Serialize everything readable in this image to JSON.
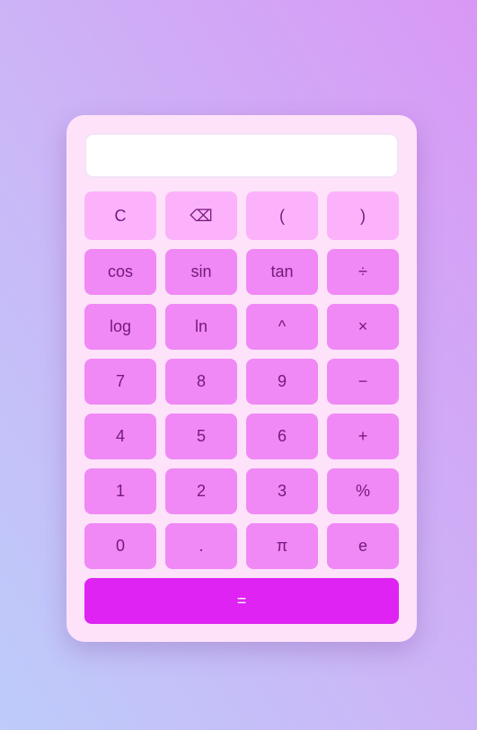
{
  "display": {
    "value": ""
  },
  "keys": [
    {
      "label": "C",
      "name": "clear-button",
      "kind": "top"
    },
    {
      "label": "⌫",
      "name": "backspace-button",
      "kind": "top"
    },
    {
      "label": "(",
      "name": "open-paren-button",
      "kind": "top"
    },
    {
      "label": ")",
      "name": "close-paren-button",
      "kind": "top"
    },
    {
      "label": "cos",
      "name": "cos-button",
      "kind": "normal"
    },
    {
      "label": "sin",
      "name": "sin-button",
      "kind": "normal"
    },
    {
      "label": "tan",
      "name": "tan-button",
      "kind": "normal"
    },
    {
      "label": "÷",
      "name": "divide-button",
      "kind": "normal"
    },
    {
      "label": "log",
      "name": "log-button",
      "kind": "normal"
    },
    {
      "label": "ln",
      "name": "ln-button",
      "kind": "normal"
    },
    {
      "label": "^",
      "name": "power-button",
      "kind": "normal"
    },
    {
      "label": "×",
      "name": "multiply-button",
      "kind": "normal"
    },
    {
      "label": "7",
      "name": "digit-7-button",
      "kind": "normal"
    },
    {
      "label": "8",
      "name": "digit-8-button",
      "kind": "normal"
    },
    {
      "label": "9",
      "name": "digit-9-button",
      "kind": "normal"
    },
    {
      "label": "−",
      "name": "subtract-button",
      "kind": "normal"
    },
    {
      "label": "4",
      "name": "digit-4-button",
      "kind": "normal"
    },
    {
      "label": "5",
      "name": "digit-5-button",
      "kind": "normal"
    },
    {
      "label": "6",
      "name": "digit-6-button",
      "kind": "normal"
    },
    {
      "label": "+",
      "name": "add-button",
      "kind": "normal"
    },
    {
      "label": "1",
      "name": "digit-1-button",
      "kind": "normal"
    },
    {
      "label": "2",
      "name": "digit-2-button",
      "kind": "normal"
    },
    {
      "label": "3",
      "name": "digit-3-button",
      "kind": "normal"
    },
    {
      "label": "%",
      "name": "percent-button",
      "kind": "normal"
    },
    {
      "label": "0",
      "name": "digit-0-button",
      "kind": "normal"
    },
    {
      "label": ".",
      "name": "decimal-point-button",
      "kind": "normal"
    },
    {
      "label": "π",
      "name": "pi-button",
      "kind": "normal"
    },
    {
      "label": "e",
      "name": "euler-button",
      "kind": "normal"
    },
    {
      "label": "=",
      "name": "equals-button",
      "kind": "equals"
    }
  ],
  "colors": {
    "background_top_right": "#d998f5",
    "background_bottom_left": "#bdccfa",
    "panel": "#fde2fa",
    "key_top_row": "#fcb2fb",
    "key": "#f088f5",
    "key_text": "#74197a",
    "equals": "#de23f3",
    "equals_text": "#ffffff"
  }
}
